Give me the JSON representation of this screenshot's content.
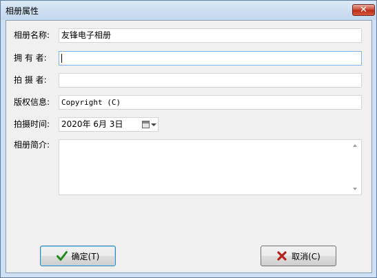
{
  "window": {
    "title": "相册属性",
    "close_label": "✕"
  },
  "form": {
    "name_label": "相册名称:",
    "name_value": "友锋电子相册",
    "owner_label": "拥 有 者:",
    "owner_value": "",
    "photographer_label": "拍 摄 者:",
    "photographer_value": "",
    "copyright_label": "版权信息:",
    "copyright_value": "Copyright (C)",
    "date_label": "拍摄时间:",
    "date_value": "2020年 6月 3日",
    "desc_label": "相册简介:",
    "desc_value": ""
  },
  "buttons": {
    "ok_label": "确定(T)",
    "cancel_label": "取消(C)"
  },
  "icons": {
    "ok": "checkmark-icon",
    "cancel": "x-mark-icon",
    "calendar": "calendar-icon"
  },
  "colors": {
    "ok_icon": "#1f8a1f",
    "cancel_icon": "#b4231a",
    "close_button": "#c8442f",
    "title_bar": "#c3d7ee"
  }
}
